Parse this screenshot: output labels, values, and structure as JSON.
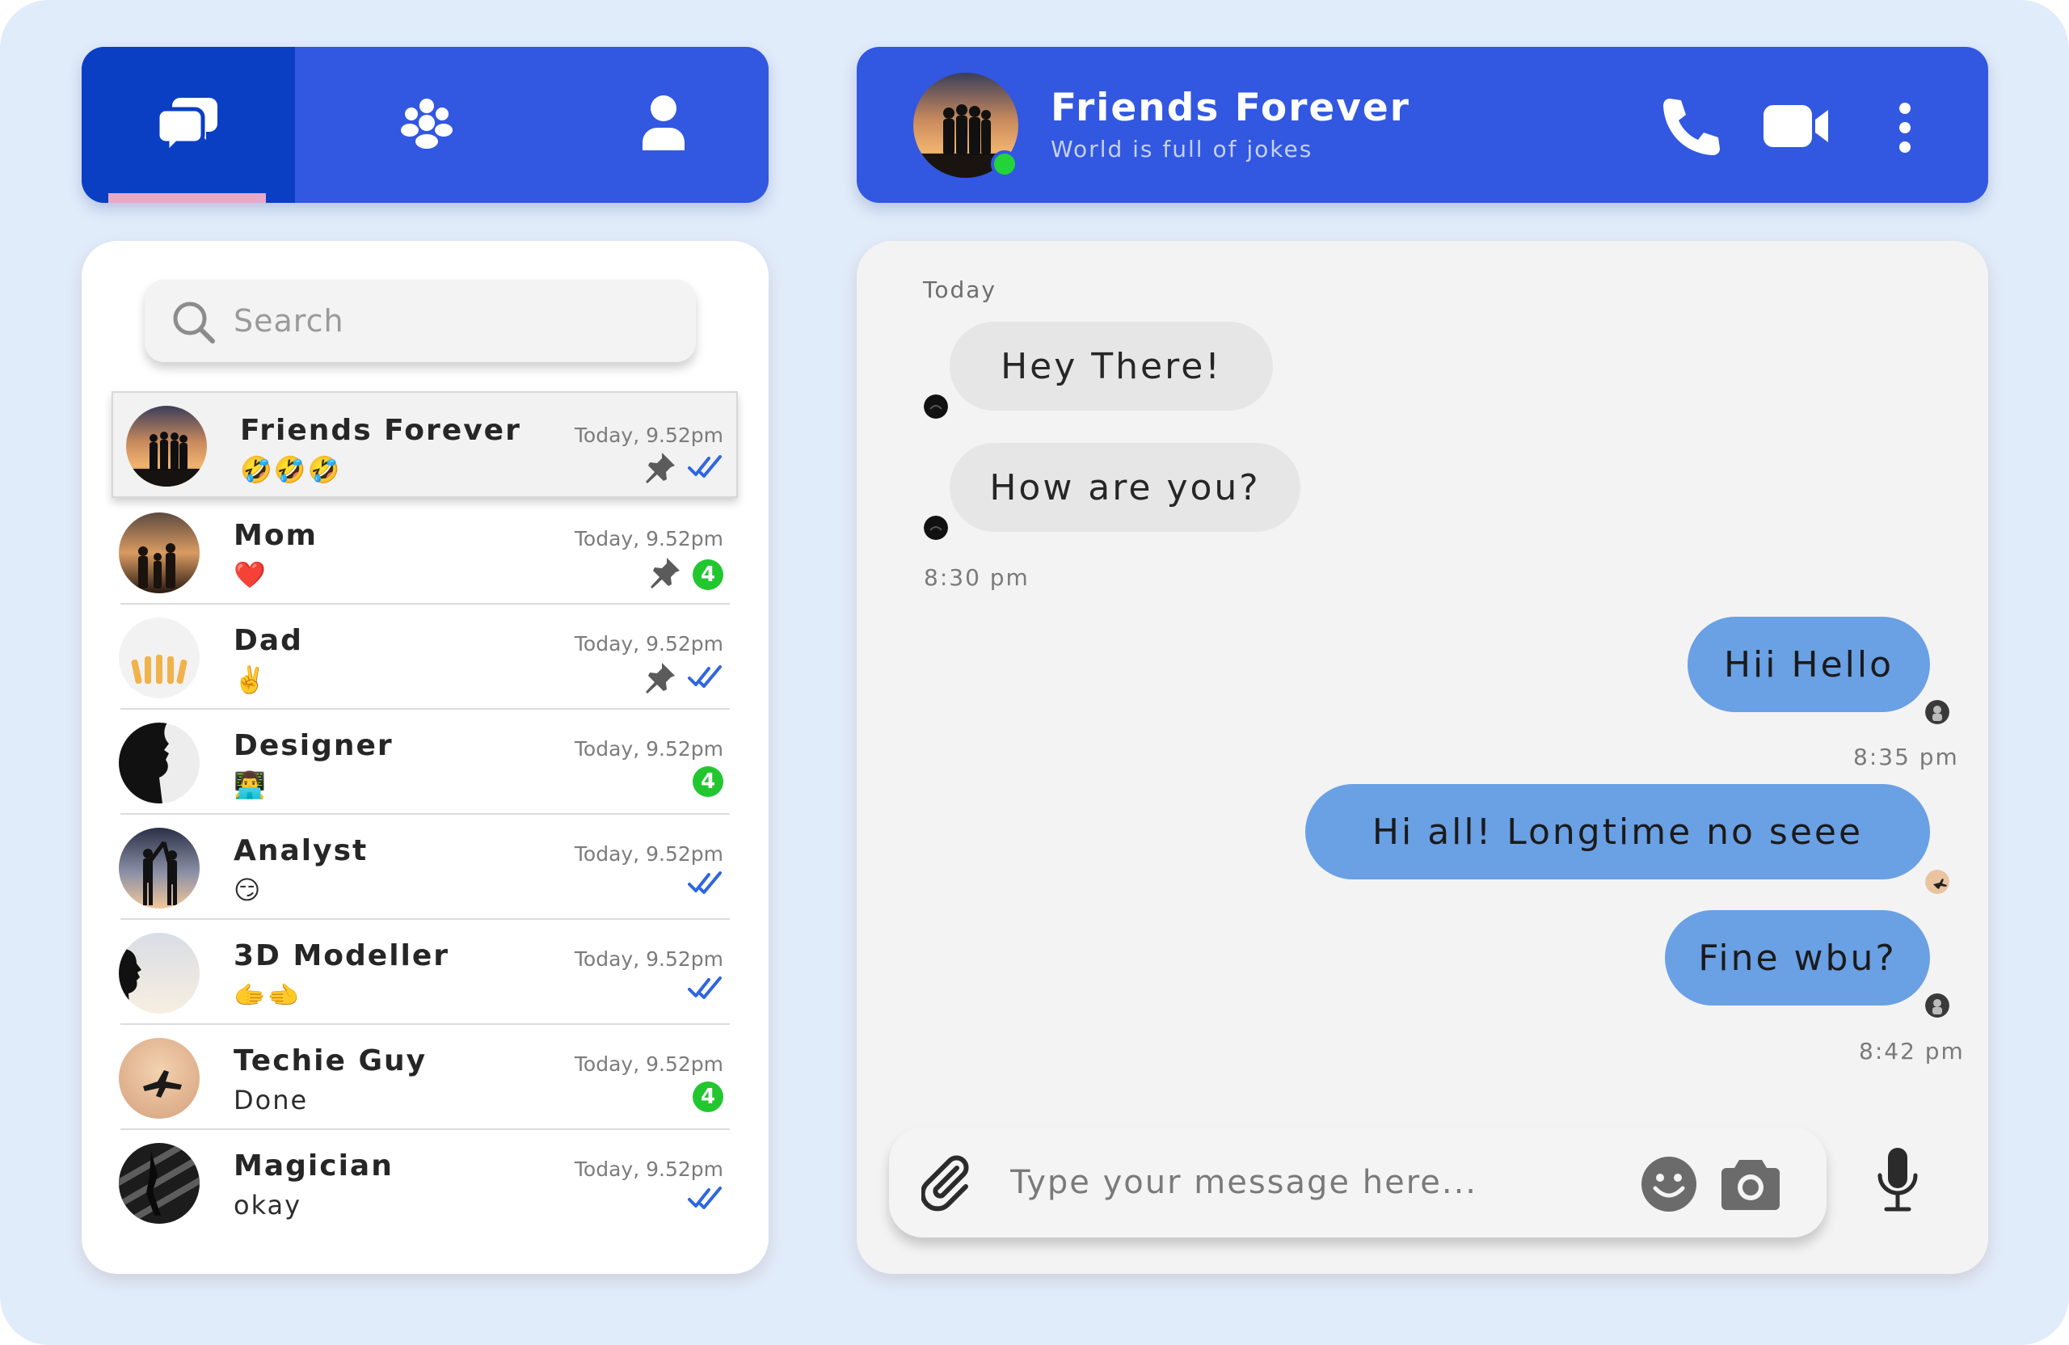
{
  "nav": {
    "tabs": [
      {
        "id": "chats",
        "icon": "chat-bubbles-icon",
        "active": true
      },
      {
        "id": "groups",
        "icon": "group-icon",
        "active": false
      },
      {
        "id": "profile",
        "icon": "person-icon",
        "active": false
      }
    ]
  },
  "header": {
    "title": "Friends Forever",
    "subtitle": "World is full of jokes",
    "status": "online",
    "actions": [
      "phone-icon",
      "video-camera-icon",
      "more-vert-icon"
    ]
  },
  "search": {
    "placeholder": "Search"
  },
  "contacts": [
    {
      "name": "Friends Forever",
      "message": "🤣🤣🤣",
      "time": "Today, 9.52pm",
      "pinned": true,
      "read": true,
      "unread": null
    },
    {
      "name": "Mom",
      "message": "❤️",
      "time": "Today, 9.52pm",
      "pinned": true,
      "read": false,
      "unread": "4"
    },
    {
      "name": "Dad",
      "message": "✌️",
      "time": "Today, 9.52pm",
      "pinned": true,
      "read": true,
      "unread": null
    },
    {
      "name": "Designer",
      "message": "👨‍💻",
      "time": "Today, 9.52pm",
      "pinned": false,
      "read": false,
      "unread": "4"
    },
    {
      "name": "Analyst",
      "message": "😏",
      "time": "Today, 9.52pm",
      "pinned": false,
      "read": true,
      "unread": null
    },
    {
      "name": "3D Modeller",
      "message": "🫱🫲",
      "time": "Today, 9.52pm",
      "pinned": false,
      "read": true,
      "unread": null
    },
    {
      "name": "Techie Guy",
      "message": "Done",
      "time": "Today, 9.52pm",
      "pinned": false,
      "read": false,
      "unread": "4"
    },
    {
      "name": "Magician",
      "message": "okay",
      "time": "Today, 9.52pm",
      "pinned": false,
      "read": true,
      "unread": null
    }
  ],
  "chat": {
    "day": "Today",
    "messages": [
      {
        "text": "Hey There!",
        "direction": "in"
      },
      {
        "text": "How are you?",
        "direction": "in"
      },
      {
        "text": "Hii Hello",
        "direction": "out"
      },
      {
        "text": "Hi all! Longtime no seee",
        "direction": "out"
      },
      {
        "text": "Fine wbu?",
        "direction": "out"
      }
    ],
    "times": [
      "8:30 pm",
      "8:35 pm",
      "8:42 pm"
    ]
  },
  "composer": {
    "placeholder": "Type your message here..."
  },
  "colors": {
    "primary": "#3257e0",
    "primary_dark": "#0a3fc4",
    "outgoing_bubble": "#6aa0e4",
    "incoming_bubble": "#e6e6e6",
    "badge": "#22c62f",
    "read_ticks": "#2f66e0",
    "background": "#e1ecfa"
  }
}
